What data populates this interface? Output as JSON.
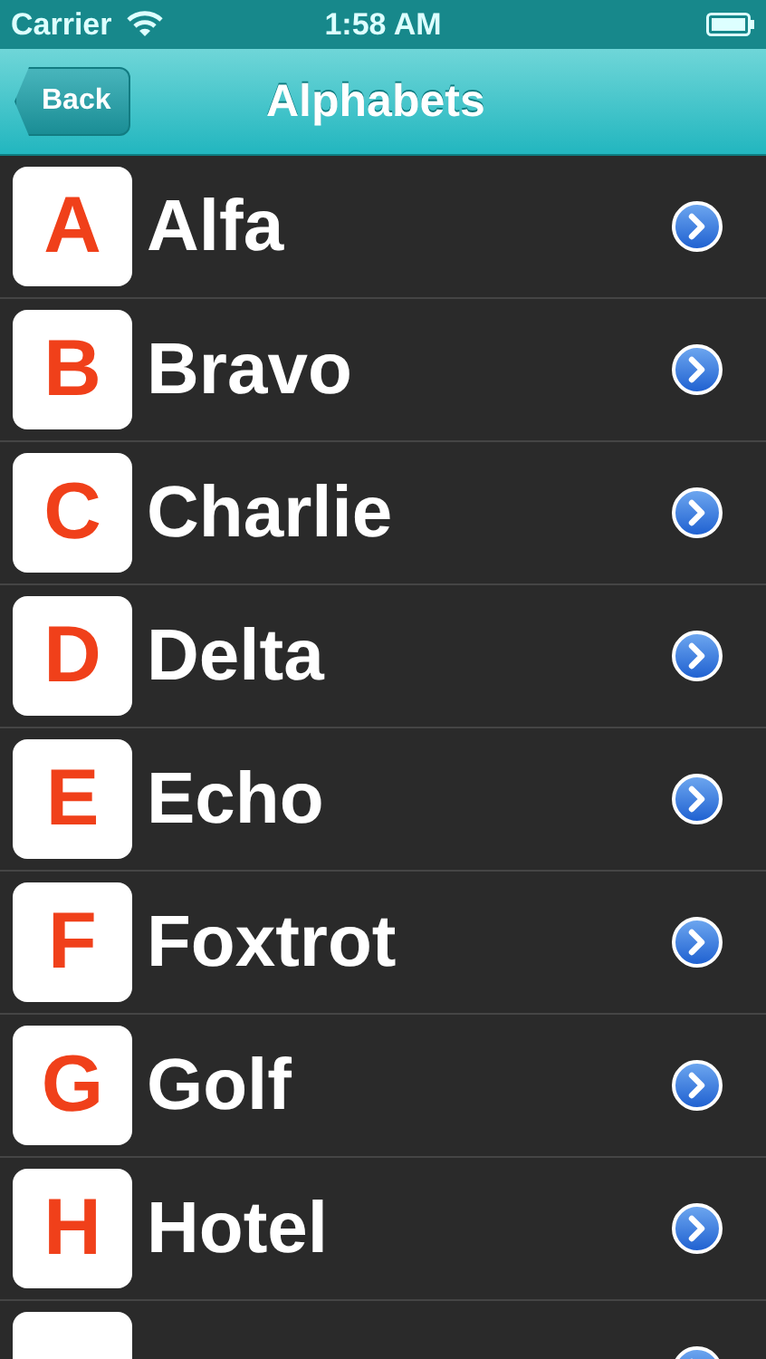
{
  "status_bar": {
    "carrier": "Carrier",
    "time": "1:58 AM"
  },
  "nav_bar": {
    "back": "Back",
    "title": "Alphabets"
  },
  "rows": [
    {
      "kind": "full",
      "letter": "A",
      "name": "Alfa"
    },
    {
      "kind": "full",
      "letter": "B",
      "name": "Bravo"
    },
    {
      "kind": "full",
      "letter": "C",
      "name": "Charlie"
    },
    {
      "kind": "full",
      "letter": "D",
      "name": "Delta"
    },
    {
      "kind": "full",
      "letter": "E",
      "name": "Echo"
    },
    {
      "kind": "full",
      "letter": "F",
      "name": "Foxtrot"
    },
    {
      "kind": "full",
      "letter": "G",
      "name": "Golf"
    },
    {
      "kind": "full",
      "letter": "H",
      "name": "Hotel"
    },
    {
      "kind": "cut"
    }
  ]
}
